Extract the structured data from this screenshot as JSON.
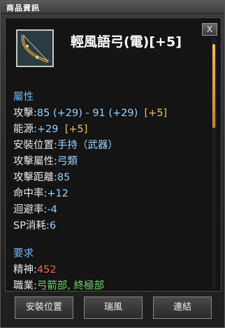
{
  "window": {
    "title": "商品資訊"
  },
  "close_label": "X",
  "item": {
    "name": "輕風語弓(電)[+5]"
  },
  "attributes": {
    "header": "屬性",
    "attack": {
      "label": "攻擊:",
      "value": "85 (+29) - 91 (+29)",
      "bonus": "[+5]"
    },
    "energy": {
      "label": "能源:",
      "value": "+29",
      "bonus": "[+5]"
    },
    "equip_slot": {
      "label": "安裝位置:",
      "value": "手持（武器）"
    },
    "attack_type": {
      "label": "攻擊屬性:",
      "value": "弓類"
    },
    "attack_range": {
      "label": "攻擊距離:",
      "value": "85"
    },
    "hit_rate": {
      "label": "命中率:",
      "value": "+12"
    },
    "evasion": {
      "label": "迴避率:",
      "value": "-4"
    },
    "sp_cost": {
      "label": "SP消耗:",
      "value": "6"
    }
  },
  "requirements": {
    "header": "要求",
    "spirit": {
      "label": "精神:",
      "value": "452"
    },
    "job": {
      "label": "職業:",
      "value": "弓箭部, 終極部"
    }
  },
  "buttons": {
    "equip_location": "安裝位置",
    "ruifeng": "瑞風",
    "link": "連結"
  },
  "colors": {
    "section_header": "#6cb8ff",
    "stat_value": "#9ad2ff",
    "bonus": "#e8c060",
    "requirement_unmet": "#ff5a5a",
    "job_value": "#6ed06e"
  },
  "icons": {
    "item": "bow-icon",
    "close": "close-icon"
  }
}
